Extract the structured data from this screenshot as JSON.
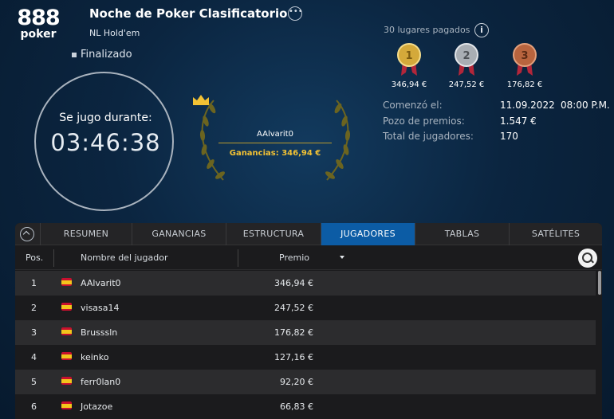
{
  "brand": {
    "number": "888",
    "word": "poker"
  },
  "tournament": {
    "title": "Noche de Poker Clasificatorio",
    "game": "NL Hold'em",
    "status": "Finalizado",
    "played_label": "Se jugo durante:",
    "duration": "03:46:38"
  },
  "winner": {
    "name": "AAlvarit0",
    "earnings": "Ganancias: 346,94 €"
  },
  "payout": {
    "paid_places": "30 lugares pagados",
    "medals": [
      {
        "rank": "1",
        "prize": "346,94 €",
        "color": "#d4a93a"
      },
      {
        "rank": "2",
        "prize": "247,52 €",
        "color": "#a9aeb4"
      },
      {
        "rank": "3",
        "prize": "176,82 €",
        "color": "#b8643e"
      }
    ]
  },
  "stats": {
    "started_label": "Comenzó el:",
    "started_date": "11.09.2022",
    "started_time": "08:00 P.M.",
    "prize_pool_label": "Pozo de premios:",
    "prize_pool": "1.547 €",
    "players_label": "Total de jugadores:",
    "players": "170"
  },
  "tabs": [
    "RESUMEN",
    "GANANCIAS",
    "ESTRUCTURA",
    "JUGADORES",
    "TABLAS",
    "SATÉLITES"
  ],
  "active_tab": "JUGADORES",
  "table": {
    "headers": {
      "pos": "Pos.",
      "name": "Nombre del jugador",
      "prize": "Premio"
    },
    "rows": [
      {
        "pos": "1",
        "name": "AAlvarit0",
        "prize": "346,94 €"
      },
      {
        "pos": "2",
        "name": "visasa14",
        "prize": "247,52 €"
      },
      {
        "pos": "3",
        "name": "Brusssln",
        "prize": "176,82 €"
      },
      {
        "pos": "4",
        "name": "keinko",
        "prize": "127,16 €"
      },
      {
        "pos": "5",
        "name": "ferr0lan0",
        "prize": "92,20 €"
      },
      {
        "pos": "6",
        "name": "Jotazoe",
        "prize": "66,83 €"
      }
    ]
  },
  "colors": {
    "accent_tab": "#0c5ca5",
    "gold": "#f3c234",
    "laurel": "#6b6420"
  }
}
